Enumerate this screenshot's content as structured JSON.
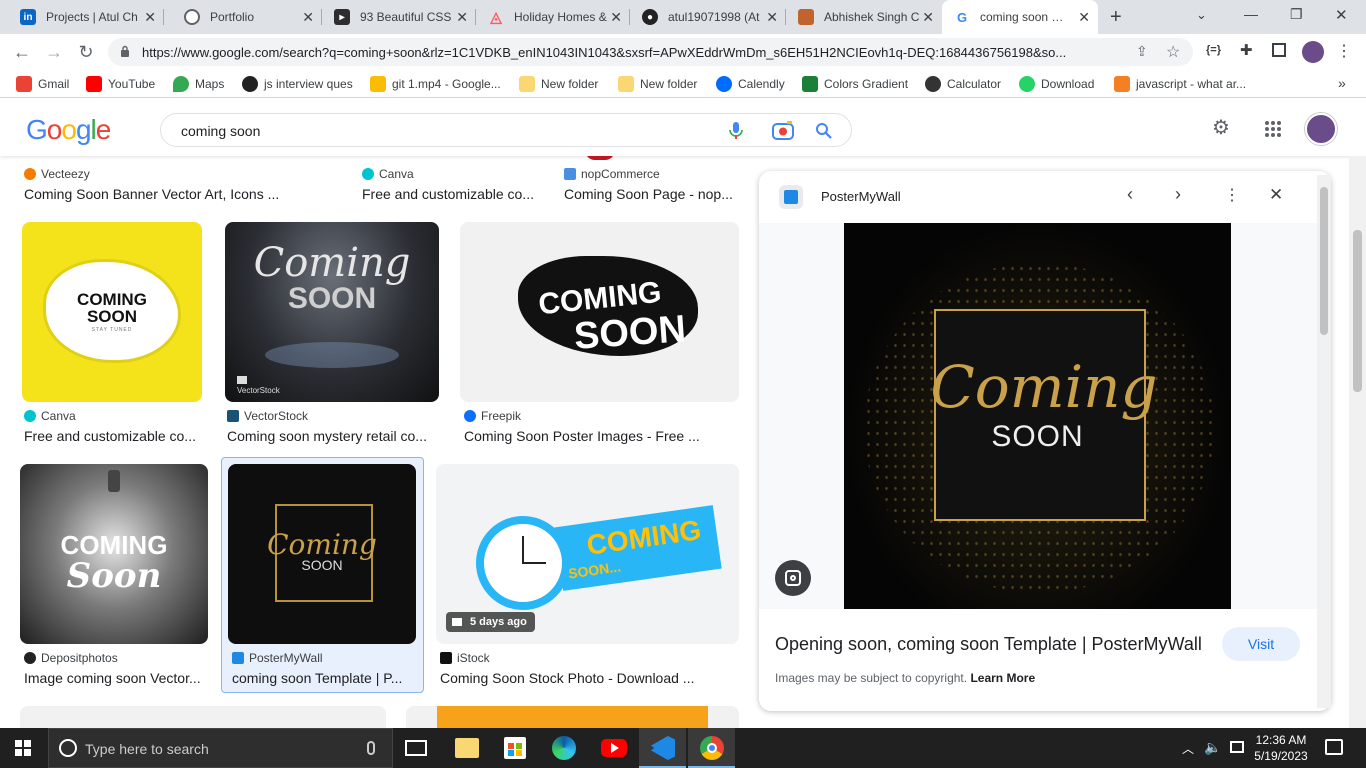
{
  "tabs": [
    {
      "title": "Projects | Atul Ch",
      "icon": "linkedin-icon",
      "color": "#0a66c2"
    },
    {
      "title": "Portfolio",
      "icon": "globe-icon",
      "color": "#5f6368"
    },
    {
      "title": "93 Beautiful CSS",
      "icon": "code-icon",
      "color": "#222"
    },
    {
      "title": "Holiday Homes &",
      "icon": "airbnb-icon",
      "color": "#ff5a5f"
    },
    {
      "title": "atul19071998 (At",
      "icon": "github-icon",
      "color": "#222"
    },
    {
      "title": "Abhishek Singh C",
      "icon": "profile-icon",
      "color": "#c0632d"
    },
    {
      "title": "coming soon - G",
      "icon": "google-icon",
      "color": "#4285f4"
    }
  ],
  "url": "https://www.google.com/search?q=coming+soon&rlz=1C1VDKB_enIN1043IN1043&sxsrf=APwXEddrWmDm_s6EH51H2NCIEovh1q-DEQ:1684436756198&so...",
  "bookmarks": [
    {
      "label": "Gmail",
      "color": "#ea4335"
    },
    {
      "label": "YouTube",
      "color": "#ff0000"
    },
    {
      "label": "Maps",
      "color": "#34a853"
    },
    {
      "label": "js interview ques",
      "color": "#222"
    },
    {
      "label": "git 1.mp4 - Google...",
      "color": "#fbbc04"
    },
    {
      "label": "New folder",
      "color": "#f9d873"
    },
    {
      "label": "New folder",
      "color": "#f9d873"
    },
    {
      "label": "Calendly",
      "color": "#006bff"
    },
    {
      "label": "Colors Gradient",
      "color": "#1a7f37"
    },
    {
      "label": "Calculator",
      "color": "#333"
    },
    {
      "label": "Download",
      "color": "#25d366"
    },
    {
      "label": "javascript - what ar...",
      "color": "#f48024"
    }
  ],
  "search": {
    "query": "coming soon",
    "logo": "Google"
  },
  "row0": [
    {
      "source": "Vecteezy",
      "title": "Coming Soon Banner Vector Art, Icons ...",
      "color": "#f57c00"
    },
    {
      "source": "Canva",
      "title": "Free and customizable co...",
      "color": "#00c4cc"
    },
    {
      "source": "nopCommerce",
      "title": "Coming Soon Page - nop...",
      "color": "#4a90e2"
    }
  ],
  "row1": [
    {
      "source": "Canva",
      "title": "Free and customizable co...",
      "color": "#00c4cc",
      "thumb_text_a": "COMING",
      "thumb_text_b": "SOON",
      "thumb_text_c": "STAY TUNED"
    },
    {
      "source": "VectorStock",
      "title": "Coming soon mystery retail co...",
      "color": "#1a5276",
      "thumb_text_a": "Coming",
      "thumb_text_b": "SOON",
      "watermark": "VectorStock"
    },
    {
      "source": "Freepik",
      "title": "Coming Soon Poster Images - Free ...",
      "color": "#0d6efd",
      "thumb_text_a": "COMING",
      "thumb_text_b": "SOON"
    }
  ],
  "row2": [
    {
      "source": "Depositphotos",
      "title": "Image coming soon Vector...",
      "color": "#222",
      "thumb_text_a": "COMING",
      "thumb_text_b": "Soon"
    },
    {
      "source": "PosterMyWall",
      "title": "coming soon Template | P...",
      "color": "#1e88e5",
      "thumb_text_a": "Coming",
      "thumb_text_b": "SOON"
    },
    {
      "source": "iStock",
      "title": "Coming Soon Stock Photo - Download ...",
      "color": "#111",
      "badge": "5 days ago",
      "thumb_text_a": "COMING",
      "thumb_text_b": "SOON..."
    }
  ],
  "panel": {
    "source": "PosterMyWall",
    "image_text_a": "Coming",
    "image_text_b": "SOON",
    "title": "Opening soon, coming soon Template | PosterMyWall",
    "visit": "Visit",
    "copyright": "Images may be subject to copyright.",
    "learn_more": "Learn More"
  },
  "taskbar": {
    "search_placeholder": "Type here to search",
    "time": "12:36 AM",
    "date": "5/19/2023"
  }
}
